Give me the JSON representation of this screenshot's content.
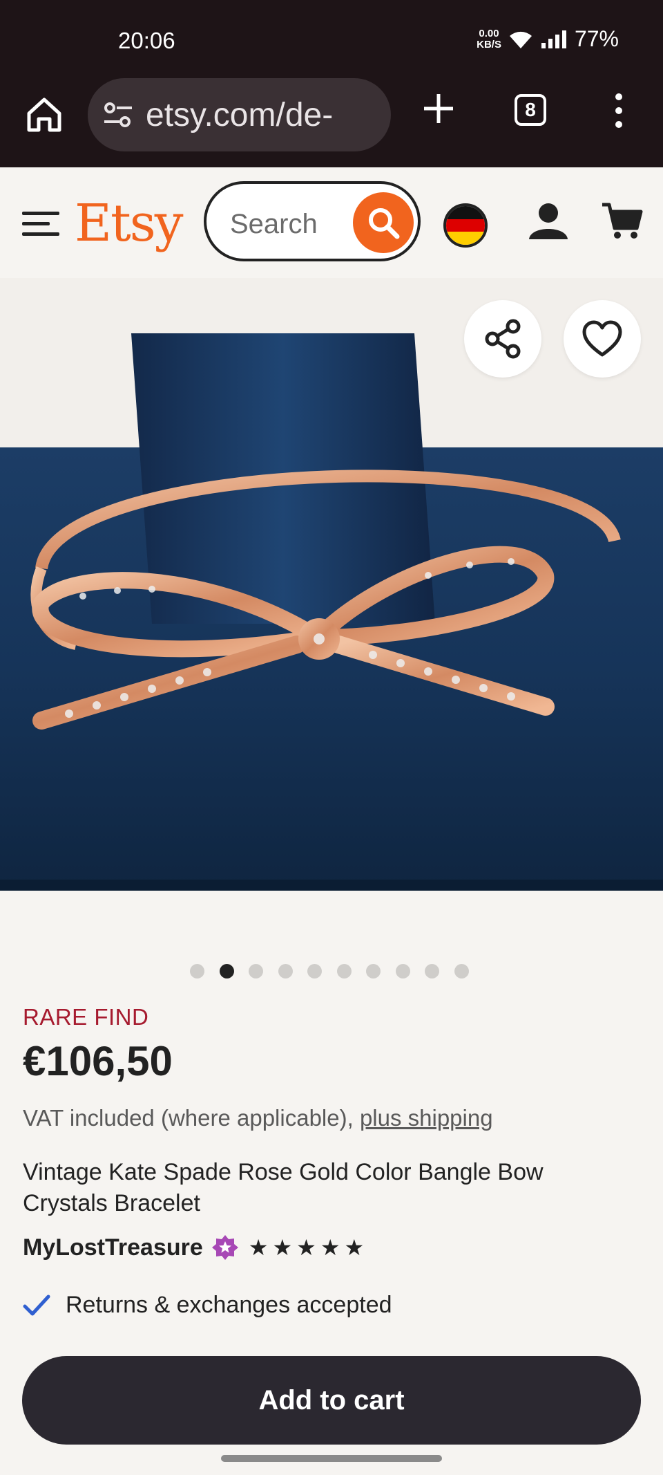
{
  "status_bar": {
    "time": "20:06",
    "net_speed_value": "0.00",
    "net_speed_unit": "KB/S",
    "battery": "77%"
  },
  "browser": {
    "url": "etsy.com/de-",
    "tab_count": "8"
  },
  "header": {
    "logo": "Etsy",
    "search_placeholder": "Search",
    "brand_color": "#f1641e"
  },
  "carousel": {
    "total_images": 10,
    "active_index": 1
  },
  "product": {
    "badge": "RARE FIND",
    "price": "€106,50",
    "vat_text": "VAT included (where applicable),",
    "shipping_link": "plus shipping",
    "title": "Vintage Kate Spade Rose Gold Color Bangle Bow Crystals Bracelet",
    "shop_name": "MyLostTreasure",
    "rating_stars": 5,
    "returns_text": "Returns & exchanges accepted",
    "add_to_cart_label": "Add to cart"
  }
}
